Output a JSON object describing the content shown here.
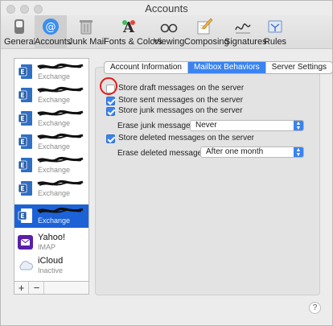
{
  "window": {
    "title": "Accounts"
  },
  "toolbar": {
    "items": [
      {
        "label": "General",
        "icon": "general-switch-icon"
      },
      {
        "label": "Accounts",
        "icon": "at-sign-icon",
        "selected": true
      },
      {
        "label": "Junk Mail",
        "icon": "trash-icon"
      },
      {
        "label": "Fonts & Colors",
        "icon": "fonts-colors-icon"
      },
      {
        "label": "Viewing",
        "icon": "glasses-icon"
      },
      {
        "label": "Composing",
        "icon": "pencil-paper-icon"
      },
      {
        "label": "Signatures",
        "icon": "signature-icon"
      },
      {
        "label": "Rules",
        "icon": "rules-icon"
      }
    ]
  },
  "accounts": [
    {
      "name": "",
      "type": "Exchange",
      "redacted": true
    },
    {
      "name": "",
      "type": "Exchange",
      "redacted": true
    },
    {
      "name": "",
      "type": "Exchange",
      "redacted": true
    },
    {
      "name": "",
      "type": "Exchange",
      "redacted": true
    },
    {
      "name": "",
      "type": "Exchange",
      "redacted": true
    },
    {
      "name": "",
      "type": "Exchange",
      "redacted": true
    },
    {
      "name": "",
      "type": "Exchange",
      "redacted": true,
      "selected": true
    },
    {
      "name": "Yahoo!",
      "type": "IMAP"
    },
    {
      "name": "iCloud",
      "type": "Inactive"
    }
  ],
  "list_footer": {
    "add": "+",
    "remove": "−"
  },
  "tabs": [
    {
      "label": "Account Information"
    },
    {
      "label": "Mailbox Behaviors",
      "active": true
    },
    {
      "label": "Server Settings"
    }
  ],
  "options": {
    "store_drafts": {
      "label": "Store draft messages on the server",
      "checked": false
    },
    "store_sent": {
      "label": "Store sent messages on the server",
      "checked": true
    },
    "store_junk": {
      "label": "Store junk messages on the server",
      "checked": true
    },
    "erase_junk_label": "Erase junk messages:",
    "erase_junk_value": "Never",
    "store_deleted": {
      "label": "Store deleted messages on the server",
      "checked": true
    },
    "erase_deleted_label": "Erase deleted messages:",
    "erase_deleted_value": "After one month"
  },
  "help": "?",
  "colors": {
    "accent": "#3a83f0",
    "selection": "#1c62d6",
    "annotation": "#e21b1b"
  }
}
